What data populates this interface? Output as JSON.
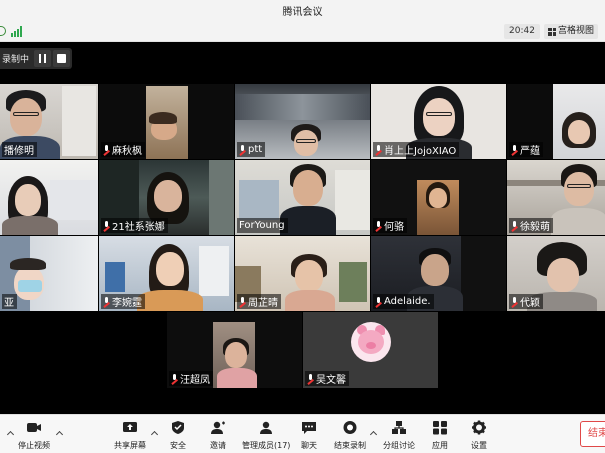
{
  "window": {
    "title": "腾讯会议"
  },
  "infobar": {
    "time": "20:42",
    "grid_view_label": "宫格视图"
  },
  "recording": {
    "status_label": "录制中"
  },
  "participants": [
    {
      "name": "播修明",
      "muted": false
    },
    {
      "name": "麻秋枫",
      "muted": true
    },
    {
      "name": "ptt",
      "muted": true
    },
    {
      "name": "肖上上JojoXIAO",
      "muted": true
    },
    {
      "name": "严蕴",
      "muted": true
    },
    {
      "name": "",
      "muted": false
    },
    {
      "name": "21社系张娜",
      "muted": true
    },
    {
      "name": "ForYoung",
      "muted": false
    },
    {
      "name": "何骆",
      "muted": true
    },
    {
      "name": "徐毅萌",
      "muted": true
    },
    {
      "name": "亚",
      "muted": false
    },
    {
      "name": "李婉霆",
      "muted": true
    },
    {
      "name": "周芷晴",
      "muted": true
    },
    {
      "name": "Adelaide.",
      "muted": true
    },
    {
      "name": "代颖",
      "muted": true
    },
    {
      "name": "汪超凤",
      "muted": true
    },
    {
      "name": "吴文馨",
      "muted": true
    }
  ],
  "toolbar": {
    "stop_video": "停止视频",
    "share_screen": "共享屏幕",
    "security": "安全",
    "invite": "邀请",
    "manage_members": "管理成员(17)",
    "chat": "聊天",
    "end_recording": "结束录制",
    "breakout": "分组讨论",
    "apps": "应用",
    "settings": "设置",
    "end_meeting": "结束"
  },
  "colors": {
    "end_red": "#e04848",
    "signal_green": "#2fa84f",
    "grid_bg": "#000000"
  }
}
